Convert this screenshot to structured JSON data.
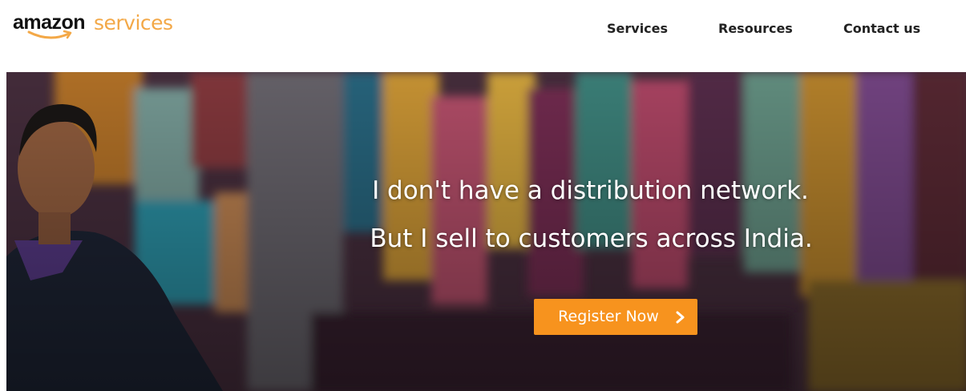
{
  "logo": {
    "word_primary": "amazon",
    "word_secondary": "services",
    "color_primary": "#111111",
    "color_secondary": "#f3a847"
  },
  "nav": {
    "items": [
      {
        "label": "Services"
      },
      {
        "label": "Resources"
      },
      {
        "label": "Contact us"
      }
    ]
  },
  "hero": {
    "line1": "I don't have a distribution network.",
    "line2": "But I sell to customers across India.",
    "cta_label": "Register Now",
    "cta_icon": "chevron-right-icon",
    "cta_color": "#f7931e"
  }
}
